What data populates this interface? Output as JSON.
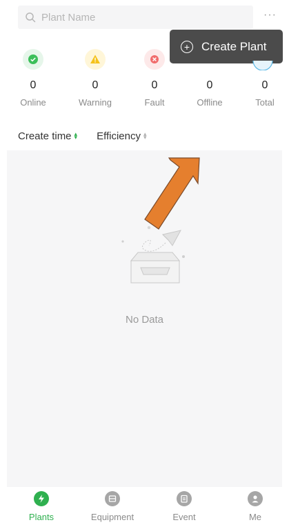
{
  "search": {
    "placeholder": "Plant Name",
    "icon": "search-icon"
  },
  "menu": {
    "more_label": "···"
  },
  "tooltip": {
    "label": "Create Plant",
    "icon": "plus-circle-icon"
  },
  "stats": [
    {
      "key": "online",
      "value": "0",
      "label": "Online",
      "color": "#3cbf5a",
      "bg": "#e6f6ea",
      "icon": "check-icon"
    },
    {
      "key": "warning",
      "value": "0",
      "label": "Warning",
      "color": "#f5c21b",
      "bg": "#fff6d8",
      "icon": "warning-icon"
    },
    {
      "key": "fault",
      "value": "0",
      "label": "Fault",
      "color": "#f16c6c",
      "bg": "#fde9e9",
      "icon": "close-icon"
    },
    {
      "key": "offline",
      "value": "0",
      "label": "Offline",
      "color": "#bdbdbd",
      "bg": "#f0f0f0",
      "icon": "offline-icon"
    },
    {
      "key": "total",
      "value": "0",
      "label": "Total",
      "color": "#5ab8e6",
      "bg": "#e6f4fb",
      "icon": "total-icon"
    }
  ],
  "sort": [
    {
      "label": "Create time",
      "accent": "#2fb04f"
    },
    {
      "label": "Efficiency",
      "accent": "#b0b0b0"
    }
  ],
  "empty": {
    "label": "No Data"
  },
  "tabs": [
    {
      "label": "Plants",
      "active": true,
      "icon": "lightning-icon"
    },
    {
      "label": "Equipment",
      "active": false,
      "icon": "equipment-icon"
    },
    {
      "label": "Event",
      "active": false,
      "icon": "clipboard-icon"
    },
    {
      "label": "Me",
      "active": false,
      "icon": "user-icon"
    }
  ],
  "colors": {
    "accent": "#2fb04f",
    "annotation_arrow": "#e57f2e",
    "tooltip_bg": "#4b4b4b"
  }
}
